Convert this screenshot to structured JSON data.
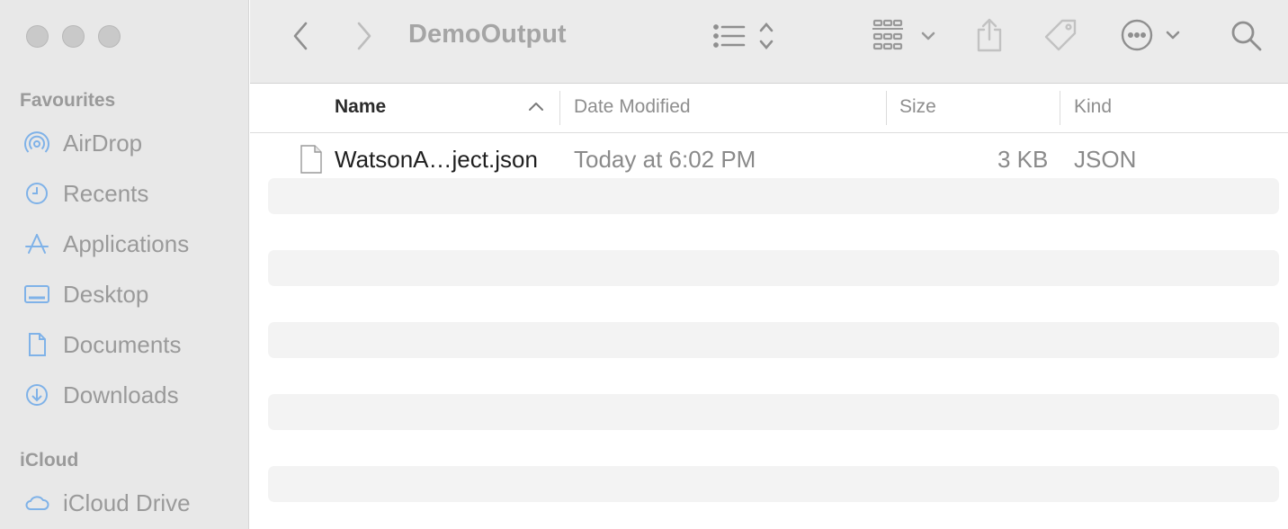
{
  "window": {
    "traffic_lights": [
      "close",
      "minimize",
      "zoom"
    ]
  },
  "sidebar": {
    "favourites_title": "Favourites",
    "favourites": [
      {
        "label": "AirDrop",
        "icon": "airdrop-icon"
      },
      {
        "label": "Recents",
        "icon": "clock-icon"
      },
      {
        "label": "Applications",
        "icon": "applications-icon"
      },
      {
        "label": "Desktop",
        "icon": "desktop-icon"
      },
      {
        "label": "Documents",
        "icon": "document-icon"
      },
      {
        "label": "Downloads",
        "icon": "download-icon"
      }
    ],
    "icloud_title": "iCloud",
    "icloud": [
      {
        "label": "iCloud Drive",
        "icon": "cloud-icon"
      }
    ],
    "icon_color": "#7fb2e8"
  },
  "toolbar": {
    "title": "DemoOutput",
    "buttons": [
      "back-icon",
      "forward-icon",
      "list-view-icon",
      "grid-view-icon",
      "share-icon",
      "tag-icon",
      "more-icon",
      "search-icon"
    ]
  },
  "columns": {
    "name": "Name",
    "date": "Date Modified",
    "size": "Size",
    "kind": "Kind",
    "sort_indicator": "ascending"
  },
  "files": [
    {
      "name": "WatsonA…ject.json",
      "date": "Today at 6:02 PM",
      "size": "3 KB",
      "kind": "JSON",
      "icon": "file-icon"
    }
  ]
}
